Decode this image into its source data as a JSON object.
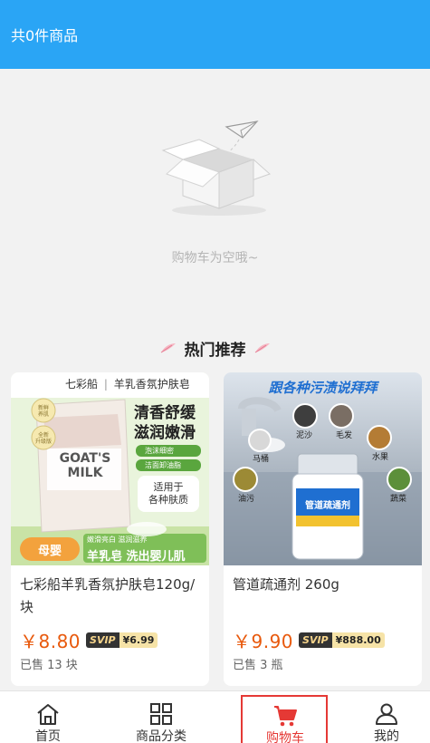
{
  "header": {
    "title": "共0件商品"
  },
  "empty": {
    "message": "购物车为空哦~"
  },
  "hot_section": {
    "title": "热门推荐"
  },
  "products": [
    {
      "name": "七彩船羊乳香氛护肤皂120g/块",
      "price": "￥8.80",
      "svip_label": "SVIP",
      "svip_price": "¥6.99",
      "sold": "已售 13 块",
      "image": {
        "brand": "七彩船",
        "subtitle": "羊乳香氛护肤皂",
        "headline_1": "清香舒缓",
        "headline_2": "滋润嫩滑",
        "bullet_1": "泡沫细密",
        "bullet_2": "洁面卸油脂",
        "suit_1": "适用于",
        "suit_2": "各种肤质",
        "box_title_1": "GOAT'S",
        "box_title_2": "MILK",
        "badge_1": "母婴",
        "strip_top": "嫩滑亮白  滋润滋养",
        "strip_main": "羊乳皂 洗出婴儿肌",
        "seal_1": "新鲜",
        "seal_2": "养肌",
        "seal_3": "全新",
        "seal_4": "升级版"
      }
    },
    {
      "name": "管道疏通剂 260g",
      "price": "￥9.90",
      "svip_label": "SVIP",
      "svip_price": "¥888.00",
      "sold": "已售 3 瓶",
      "image": {
        "headline": "跟各种污渍说拜拜",
        "label_1": "泥沙",
        "label_2": "毛发",
        "label_3": "马桶",
        "label_4": "水果",
        "label_5": "油污",
        "label_6": "蔬菜",
        "bottle_text": "管道疏通剂"
      }
    }
  ],
  "tabbar": [
    {
      "label": "首页",
      "icon": "home-icon"
    },
    {
      "label": "商品分类",
      "icon": "category-icon"
    },
    {
      "label": "购物车",
      "icon": "cart-icon"
    },
    {
      "label": "我的",
      "icon": "user-icon"
    }
  ],
  "colors": {
    "header": "#2aa5f5",
    "price": "#e8590c",
    "active_tab": "#e53935"
  }
}
